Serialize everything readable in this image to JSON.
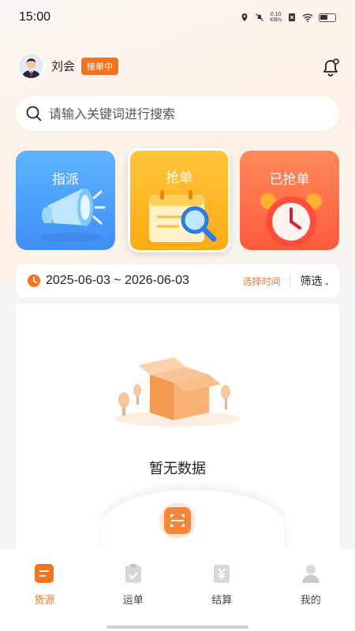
{
  "status": {
    "time": "15:00",
    "net_speed": "0.10",
    "net_unit": "KB/s"
  },
  "user": {
    "name": "刘会",
    "status_badge": "接单中"
  },
  "search": {
    "placeholder": "请输入关键词进行搜索"
  },
  "cards": [
    {
      "label": "指派"
    },
    {
      "label": "抢单"
    },
    {
      "label": "已抢单"
    }
  ],
  "date_filter": {
    "range": "2025-06-03 ~ 2026-06-03",
    "pick_label": "选择时间",
    "filter_label": "筛选"
  },
  "empty_text": "暂无数据",
  "tabs": [
    {
      "label": "货源",
      "active": true
    },
    {
      "label": "运单"
    },
    {
      "label": "结算"
    },
    {
      "label": "我的"
    }
  ],
  "colors": {
    "accent": "#f5731f",
    "card_blue": "#4a9cf8",
    "card_yellow": "#ffb81f",
    "card_red": "#ff6a46"
  }
}
